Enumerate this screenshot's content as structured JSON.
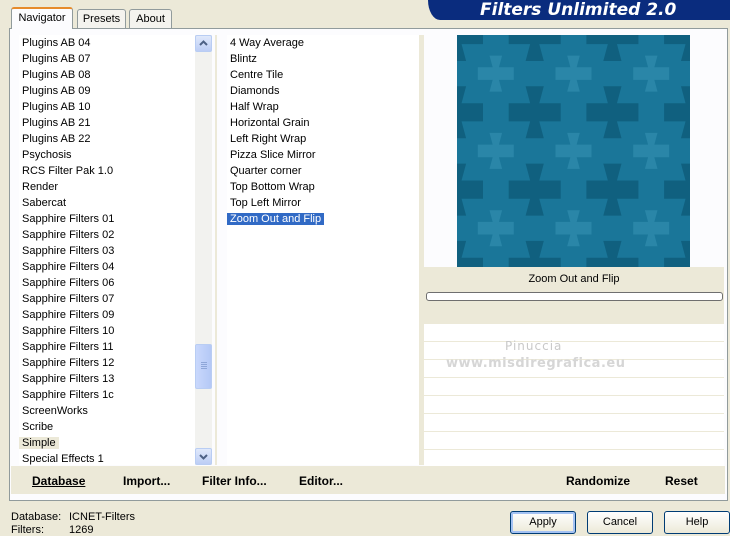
{
  "app_title": "Filters Unlimited 2.0",
  "tabs": [
    {
      "label": "Navigator",
      "active": true
    },
    {
      "label": "Presets",
      "active": false
    },
    {
      "label": "About",
      "active": false
    }
  ],
  "categories": [
    "Plugins AB 04",
    "Plugins AB 07",
    "Plugins AB 08",
    "Plugins AB 09",
    "Plugins AB 10",
    "Plugins AB 21",
    "Plugins AB 22",
    "Psychosis",
    "RCS Filter Pak 1.0",
    "Render",
    "Sabercat",
    "Sapphire Filters 01",
    "Sapphire Filters 02",
    "Sapphire Filters 03",
    "Sapphire Filters 04",
    "Sapphire Filters 06",
    "Sapphire Filters 07",
    "Sapphire Filters 09",
    "Sapphire Filters 10",
    "Sapphire Filters 11",
    "Sapphire Filters 12",
    "Sapphire Filters 13",
    "Sapphire Filters 1c",
    "ScreenWorks",
    "Scribe",
    "Simple",
    "Special Effects 1"
  ],
  "selected_category": "Simple",
  "filters": [
    "4 Way Average",
    "Blintz",
    "Centre Tile",
    "Diamonds",
    "Half Wrap",
    "Horizontal Grain",
    "Left Right Wrap",
    "Pizza Slice Mirror",
    "Quarter corner",
    "Top Bottom Wrap",
    "Top Left Mirror",
    "Zoom Out and Flip"
  ],
  "selected_filter": "Zoom Out and Flip",
  "preview": {
    "filter_name": "Zoom Out and Flip",
    "colors": {
      "base": "#1a7699",
      "dark": "#10607f",
      "light": "#2a86a8"
    }
  },
  "watermark": {
    "line1": "Pinuccia",
    "line2": "www.misdiregrafica.eu"
  },
  "toolbar": {
    "database": "Database",
    "import": "Import...",
    "filter_info": "Filter Info...",
    "editor": "Editor...",
    "randomize": "Randomize",
    "reset": "Reset"
  },
  "status": {
    "database_label": "Database:",
    "database_value": "ICNET-Filters",
    "filters_label": "Filters:",
    "filters_value": "1269"
  },
  "buttons": {
    "apply": "Apply",
    "cancel": "Cancel",
    "help": "Help"
  },
  "colors": {
    "banner": "#0a2c7e",
    "selection": "#316ac5",
    "tab_accent": "#e68b2c"
  }
}
